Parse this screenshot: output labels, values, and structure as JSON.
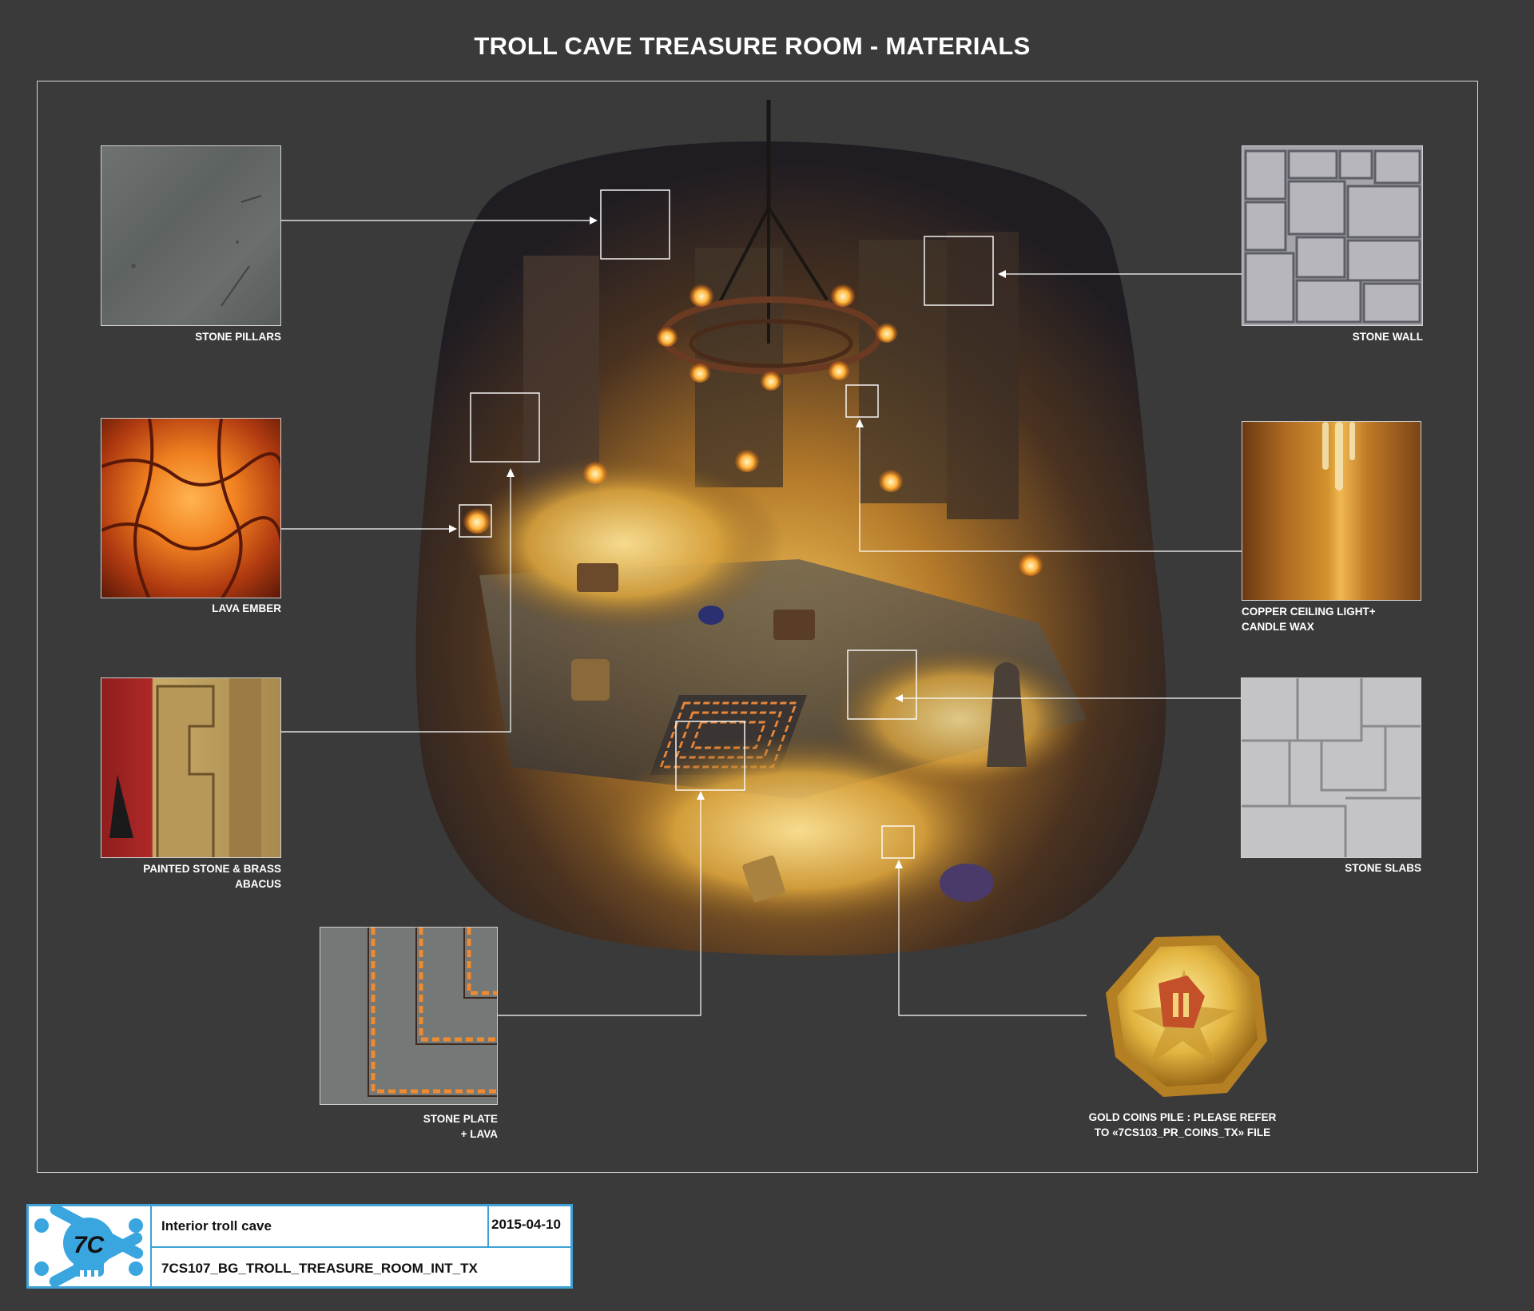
{
  "title": "TROLL CAVE TREASURE ROOM - MATERIALS",
  "materials": {
    "stone_pillars": "STONE PILLARS",
    "lava_ember": "LAVA EMBER",
    "painted_stone": "PAINTED STONE & BRASS ABACUS",
    "stone_plate_line1": "STONE PLATE",
    "stone_plate_line2": "+ LAVA",
    "stone_wall": "STONE WALL",
    "copper_line1": "COPPER CEILING LIGHT+",
    "copper_line2": "CANDLE WAX",
    "stone_slabs": "STONE SLABS",
    "gold_line1": "GOLD COINS PILE : PLEASE REFER",
    "gold_line2": "TO «7CS103_PR_COINS_TX» FILE"
  },
  "titleblock": {
    "description": "Interior troll cave",
    "date": "2015-04-10",
    "filename": "7CS107_BG_TROLL_TREASURE_ROOM_INT_TX",
    "logo_text": "7C"
  },
  "colors": {
    "background": "#3a3a3a",
    "frame": "#d8d8d8",
    "titleblock_border": "#3da1d6",
    "logo": "#3aa6df"
  }
}
